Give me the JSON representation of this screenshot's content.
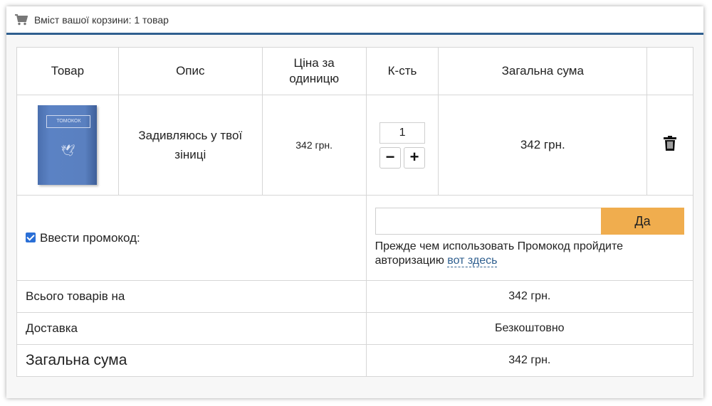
{
  "header": {
    "title": "Вміст вашої корзини: 1 товар"
  },
  "table": {
    "columns": [
      "Товар",
      "Опис",
      "Ціна за одиницю",
      "К-сть",
      "Загальна сума",
      ""
    ],
    "col_price_line1": "Ціна за",
    "col_price_line2": "одиницю"
  },
  "item": {
    "book_cover_text": "ТОМОКОК",
    "description": "Задивляюсь у твої зіниці",
    "unit_price": "342 грн.",
    "quantity": "1",
    "minus_label": "−",
    "plus_label": "+",
    "total": "342 грн.",
    "delete_icon": "trash-icon"
  },
  "promo": {
    "checkbox_checked": true,
    "label": "Ввести промокод:",
    "input_value": "",
    "submit_label": "Да",
    "note": "Прежде чем использовать Промокод пройдите авторизацию",
    "link_text": "вот здесь"
  },
  "summary": {
    "subtotal_label": "Всього товарів на",
    "subtotal_value": "342 грн.",
    "delivery_label": "Доставка",
    "delivery_value": "Безкоштовно",
    "total_label": "Загальна сума",
    "total_value": "342 грн."
  },
  "colors": {
    "accent": "#2f5f8f",
    "button": "#f0ad4e",
    "checkbox": "#2a6fd6"
  }
}
